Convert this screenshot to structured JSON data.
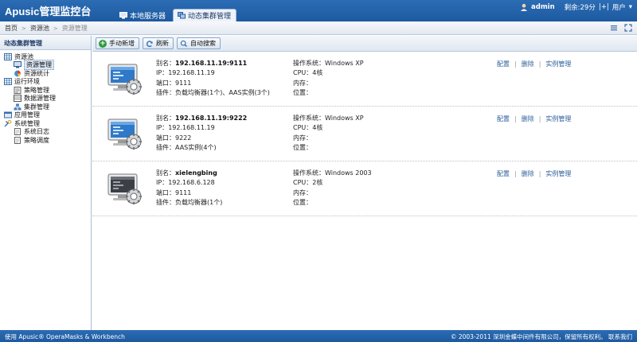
{
  "header": {
    "logo": "Apusic管理监控台",
    "tabs": [
      {
        "label": "本地服务器",
        "active": false
      },
      {
        "label": "动态集群管理",
        "active": true
      }
    ],
    "user": "admin",
    "remaining": "剩余:29分",
    "logout": "|+|",
    "user_menu": "用户"
  },
  "breadcrumb": {
    "items": [
      "首页",
      "资源池",
      "资源管理"
    ]
  },
  "sidebar": {
    "title": "动态集群管理",
    "tree": [
      {
        "label": "资源池",
        "level": 0,
        "icon": "grid-icon",
        "selected": false
      },
      {
        "label": "资源管理",
        "level": 1,
        "icon": "server-icon",
        "selected": true
      },
      {
        "label": "资源统计",
        "level": 1,
        "icon": "pie-chart-icon",
        "selected": false
      },
      {
        "label": "运行环境",
        "level": 0,
        "icon": "grid-icon",
        "selected": false
      },
      {
        "label": "策略管理",
        "level": 1,
        "icon": "policy-icon",
        "selected": false
      },
      {
        "label": "数据源管理",
        "level": 1,
        "icon": "datasource-icon",
        "selected": false
      },
      {
        "label": "集群管理",
        "level": 1,
        "icon": "cluster-icon",
        "selected": false
      },
      {
        "label": "应用管理",
        "level": 0,
        "icon": "app-icon",
        "selected": false
      },
      {
        "label": "系统管理",
        "level": 0,
        "icon": "tools-icon",
        "selected": false
      },
      {
        "label": "系统日志",
        "level": 1,
        "icon": "log-icon",
        "selected": false
      },
      {
        "label": "策略调度",
        "level": 1,
        "icon": "schedule-icon",
        "selected": false
      }
    ]
  },
  "toolbar": {
    "add_label": "手动新增",
    "refresh_label": "刷新",
    "search_label": "自动搜索"
  },
  "labels": {
    "alias": "别名：",
    "ip": "IP：",
    "port": "端口：",
    "plugin": "插件：",
    "os": "操作系统：",
    "cpu": "CPU：",
    "memory": "内存：",
    "location": "位置："
  },
  "actions": {
    "config": "配置",
    "delete": "删除",
    "instance": "实例管理"
  },
  "resources": [
    {
      "alias": "192.168.11.19:9111",
      "ip": "192.168.11.19",
      "port": "9111",
      "plugin": "负载均衡器(1个)、AAS实例(3个)",
      "os": "Windows XP",
      "cpu": "4核",
      "memory": "",
      "location": "",
      "active": true
    },
    {
      "alias": "192.168.11.19:9222",
      "ip": "192.168.11.19",
      "port": "9222",
      "plugin": "AAS实例(4个)",
      "os": "Windows XP",
      "cpu": "4核",
      "memory": "",
      "location": "",
      "active": true
    },
    {
      "alias": "xielengbing",
      "ip": "192.168.6.128",
      "port": "9111",
      "plugin": "负载均衡器(1个)",
      "os": "Windows 2003",
      "cpu": "2核",
      "memory": "",
      "location": "",
      "active": false
    }
  ],
  "footer": {
    "left": "使用 Apusic® OperaMasks & Workbench",
    "right": "© 2003-2011 深圳金蝶中间件有限公司，保留所有权利。 联系我们"
  }
}
